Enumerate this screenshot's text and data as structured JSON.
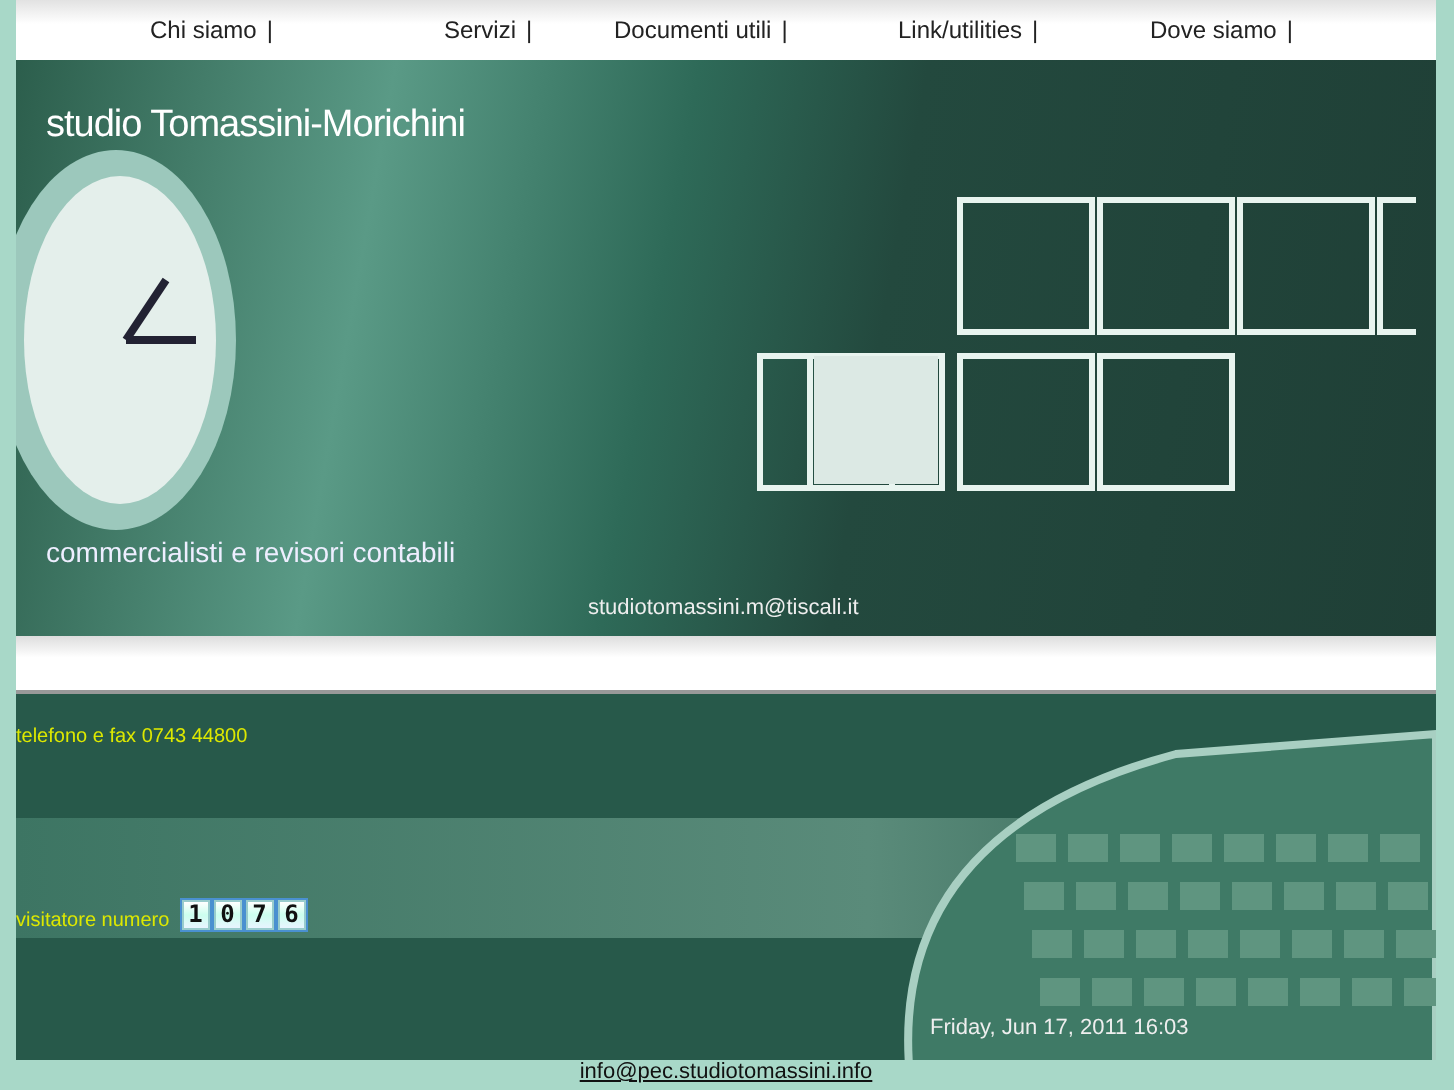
{
  "nav": [
    {
      "label": "Chi siamo",
      "separator": "|"
    },
    {
      "label": "Servizi",
      "separator": "|"
    },
    {
      "label": "Documenti utili",
      "separator": "|"
    },
    {
      "label": "Link/utilities",
      "separator": "|"
    },
    {
      "label": "Dove siamo",
      "separator": "|"
    }
  ],
  "banner": {
    "title": "studio Tomassini-Morichini",
    "subtitle": "commercialisti e revisori contabili",
    "email": "studiotomassini.m@tiscali.it"
  },
  "contact": {
    "phone": "telefono e fax  0743 44800"
  },
  "counter": {
    "label": "visitatore numero",
    "digits": [
      "1",
      "0",
      "7",
      "6"
    ]
  },
  "datetime": "Friday, Jun 17, 2011 16:03",
  "footer": {
    "link": "info@pec.studiotomassini.info"
  }
}
